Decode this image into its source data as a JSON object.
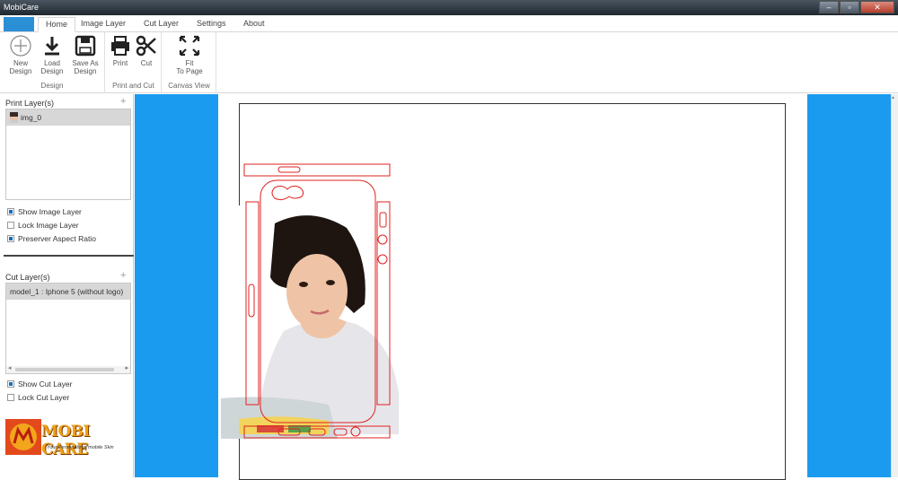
{
  "window": {
    "title": "MobiCare",
    "min": "–",
    "max": "▫",
    "close": "✕"
  },
  "tabs": [
    "Home",
    "Image Layer",
    "Cut Layer",
    "Settings",
    "About"
  ],
  "ribbon": {
    "design": {
      "caption": "Design",
      "new": [
        "New",
        "Design"
      ],
      "load": [
        "Load",
        "Design"
      ],
      "save": [
        "Save As",
        "Design"
      ]
    },
    "print_cut": {
      "caption": "Print and Cut",
      "print": "Print",
      "cut": "Cut"
    },
    "canvas_view": {
      "caption": "Canvas View",
      "fit": [
        "Fit",
        "To Page"
      ]
    }
  },
  "print_layers": {
    "title": "Print Layer(s)",
    "items": [
      "img_0"
    ]
  },
  "image_options": [
    {
      "label": "Show Image Layer",
      "checked": true
    },
    {
      "label": "Lock Image Layer",
      "checked": false
    },
    {
      "label": "Preserver Aspect Ratio",
      "checked": true
    }
  ],
  "cut_layers": {
    "title": "Cut Layer(s)",
    "items": [
      "model_1 : Iphone 5 (without logo)"
    ]
  },
  "cut_options": [
    {
      "label": "Show Cut Layer",
      "checked": true
    },
    {
      "label": "Lock Cut Layer",
      "checked": false
    }
  ],
  "logo": {
    "name": "MOBI CARE",
    "tagline": "Your Personalized mobile Skin"
  },
  "colors": {
    "accent": "#1a9bf0",
    "cut_line": "#e02020",
    "tab_accent": "#2b8fd6"
  }
}
